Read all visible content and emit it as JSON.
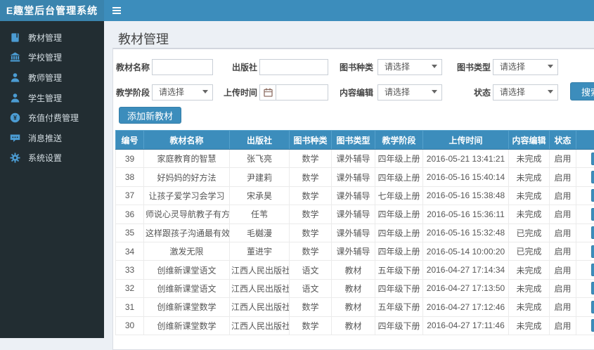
{
  "app": {
    "title": "E趣堂后台管理系统"
  },
  "page": {
    "title": "教材管理"
  },
  "sidebar": {
    "items": [
      {
        "icon": "book-icon",
        "label": "教材管理"
      },
      {
        "icon": "school-icon",
        "label": "学校管理"
      },
      {
        "icon": "teacher-icon",
        "label": "教师管理"
      },
      {
        "icon": "student-icon",
        "label": "学生管理"
      },
      {
        "icon": "payment-icon",
        "label": "充值付费管理"
      },
      {
        "icon": "message-icon",
        "label": "消息推送"
      },
      {
        "icon": "settings-icon",
        "label": "系统设置"
      }
    ]
  },
  "filter": {
    "fields": [
      {
        "label": "教材名称",
        "type": "text",
        "value": ""
      },
      {
        "label": "出版社",
        "type": "text",
        "value": ""
      },
      {
        "label": "图书种类",
        "type": "select",
        "value": "请选择"
      },
      {
        "label": "图书类型",
        "type": "select",
        "value": "请选择"
      },
      {
        "label": "教学阶段",
        "type": "select",
        "value": "请选择"
      },
      {
        "label": "上传时间",
        "type": "date",
        "value": ""
      },
      {
        "label": "内容编辑",
        "type": "select",
        "value": "请选择"
      },
      {
        "label": "状态",
        "type": "select",
        "value": "请选择"
      }
    ],
    "search_label": "搜索"
  },
  "toolbar": {
    "add_label": "添加新教材"
  },
  "table": {
    "headers": [
      "编号",
      "教材名称",
      "出版社",
      "图书种类",
      "图书类型",
      "教学阶段",
      "上传时间",
      "内容编辑",
      "状态",
      ""
    ],
    "rows": [
      [
        "39",
        "家庭教育的智慧",
        "张飞亮",
        "数学",
        "课外辅导",
        "四年级上册",
        "2016-05-21 13:41:21",
        "未完成",
        "启用"
      ],
      [
        "38",
        "好妈妈的好方法",
        "尹建莉",
        "数学",
        "课外辅导",
        "四年级上册",
        "2016-05-16 15:40:14",
        "未完成",
        "启用"
      ],
      [
        "37",
        "让孩子爱学习会学习",
        "宋承昊",
        "数学",
        "课外辅导",
        "七年级上册",
        "2016-05-16 15:38:48",
        "未完成",
        "启用"
      ],
      [
        "36",
        "师说心灵导航教子有方",
        "任苇",
        "数学",
        "课外辅导",
        "四年级上册",
        "2016-05-16 15:36:11",
        "未完成",
        "启用"
      ],
      [
        "35",
        "这样跟孩子沟通最有效",
        "毛樾漫",
        "数学",
        "课外辅导",
        "四年级上册",
        "2016-05-16 15:32:48",
        "已完成",
        "启用"
      ],
      [
        "34",
        "激发无限",
        "董进宇",
        "数学",
        "课外辅导",
        "四年级上册",
        "2016-05-14 10:00:20",
        "已完成",
        "启用"
      ],
      [
        "33",
        "创维新课堂语文",
        "江西人民出版社",
        "语文",
        "教材",
        "五年级下册",
        "2016-04-27 17:14:34",
        "未完成",
        "启用"
      ],
      [
        "32",
        "创维新课堂语文",
        "江西人民出版社",
        "语文",
        "教材",
        "四年级下册",
        "2016-04-27 17:13:50",
        "未完成",
        "启用"
      ],
      [
        "31",
        "创维新课堂数学",
        "江西人民出版社",
        "数学",
        "教材",
        "五年级下册",
        "2016-04-27 17:12:46",
        "未完成",
        "启用"
      ],
      [
        "30",
        "创维新课堂数学",
        "江西人民出版社",
        "数学",
        "教材",
        "四年级下册",
        "2016-04-27 17:11:46",
        "未完成",
        "启用"
      ]
    ]
  },
  "colors": {
    "navbar": "#3c8dbc",
    "logo": "#3a84ae",
    "sidebar": "#222d32",
    "sidebar_icon": "#4b9cd3",
    "content_bg": "#ecf0f5",
    "table_header": "#3c8dbc",
    "button": "#3c8dbc"
  }
}
